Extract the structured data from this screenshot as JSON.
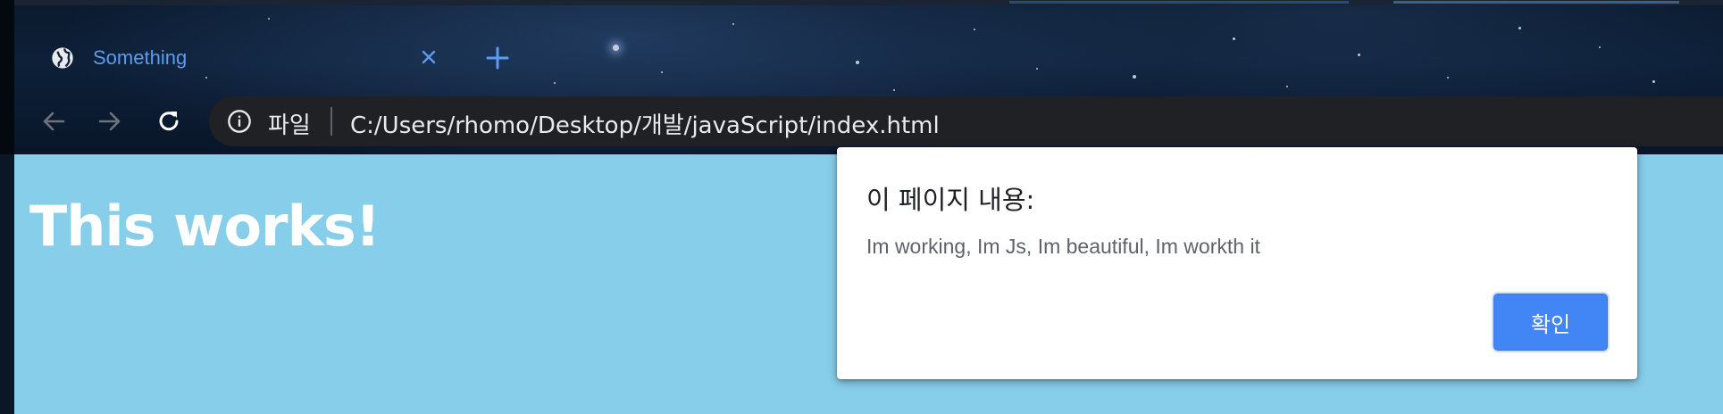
{
  "browser": {
    "tab": {
      "title": "Something",
      "icon": "globe-icon"
    },
    "address_bar": {
      "scheme_label": "파일",
      "url": "C:/Users/rhomo/Desktop/개발/javaScript/index.html"
    },
    "colors": {
      "tab_title": "#5b9cf0",
      "accent": "#4285f4",
      "omnibox": "#202124"
    }
  },
  "page": {
    "heading": "This works!",
    "background": "#87ceeb"
  },
  "alert": {
    "title": "이 페이지 내용:",
    "message": "Im working, Im Js, Im beautiful, Im workth it",
    "ok_label": "확인"
  }
}
